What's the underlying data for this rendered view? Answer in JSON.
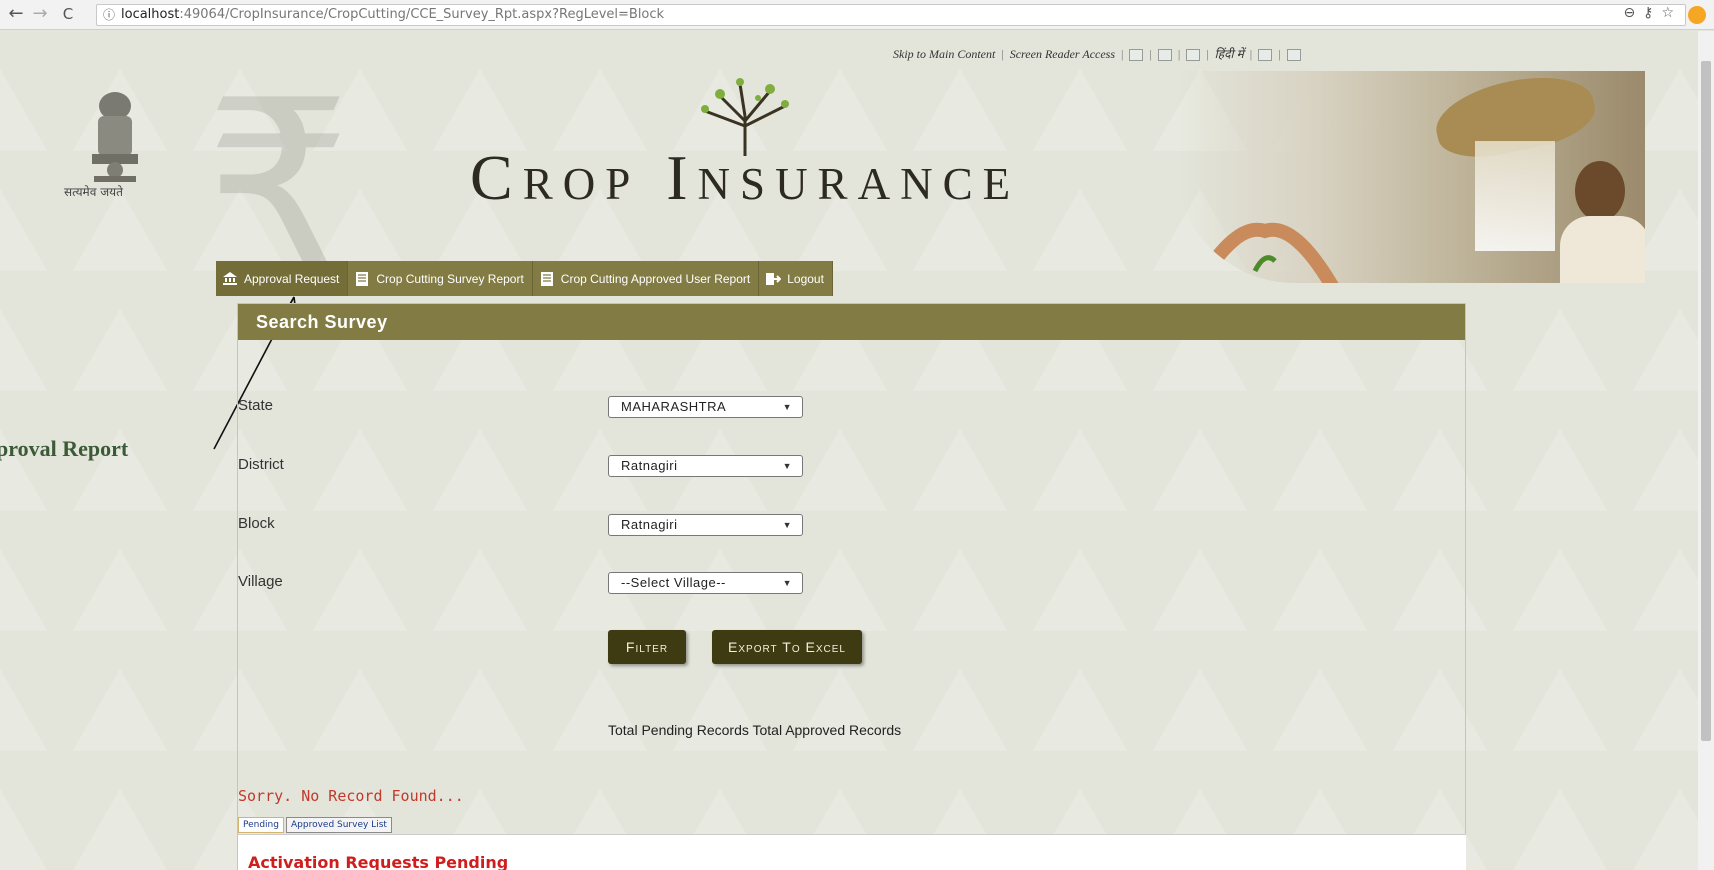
{
  "browser": {
    "url_host": "localhost",
    "url_path": ":49064/CropInsurance/CropCutting/CCE_Survey_Rpt.aspx?RegLevel=Block"
  },
  "access_bar": {
    "skip_link": "Skip to Main Content",
    "screen_reader": "Screen Reader Access",
    "hindi": "हिंदी में"
  },
  "header": {
    "emblem_caption": "सत्यमेव जयते",
    "title": "Crop Insurance"
  },
  "menu": {
    "items": [
      {
        "label": "Approval Request",
        "icon": "government-building-icon"
      },
      {
        "label": "Crop Cutting Survey Report",
        "icon": "report-document-icon"
      },
      {
        "label": "Crop Cutting Approved User Report",
        "icon": "report-document-icon"
      },
      {
        "label": "Logout",
        "icon": "logout-icon"
      }
    ]
  },
  "annotation": {
    "text": "proval Report"
  },
  "panel": {
    "title": "Search Survey",
    "fields": {
      "state_label": "State",
      "state_value": "MAHARASHTRA",
      "district_label": "District",
      "district_value": "Ratnagiri",
      "block_label": "Block",
      "block_value": "Ratnagiri",
      "village_label": "Village",
      "village_value": "--Select Village--"
    },
    "buttons": {
      "filter": "Filter",
      "export": "Export To Excel"
    },
    "totals_text": "Total Pending Records  Total Approved Records",
    "no_record": "Sorry. No Record Found...",
    "tabs": [
      "Pending",
      "Approved Survey List"
    ],
    "pending_title": "Activation Requests Pending"
  },
  "colors": {
    "olive_header": "#827b43",
    "button_dark": "#3e3a12",
    "error_red": "#d01e1e"
  }
}
